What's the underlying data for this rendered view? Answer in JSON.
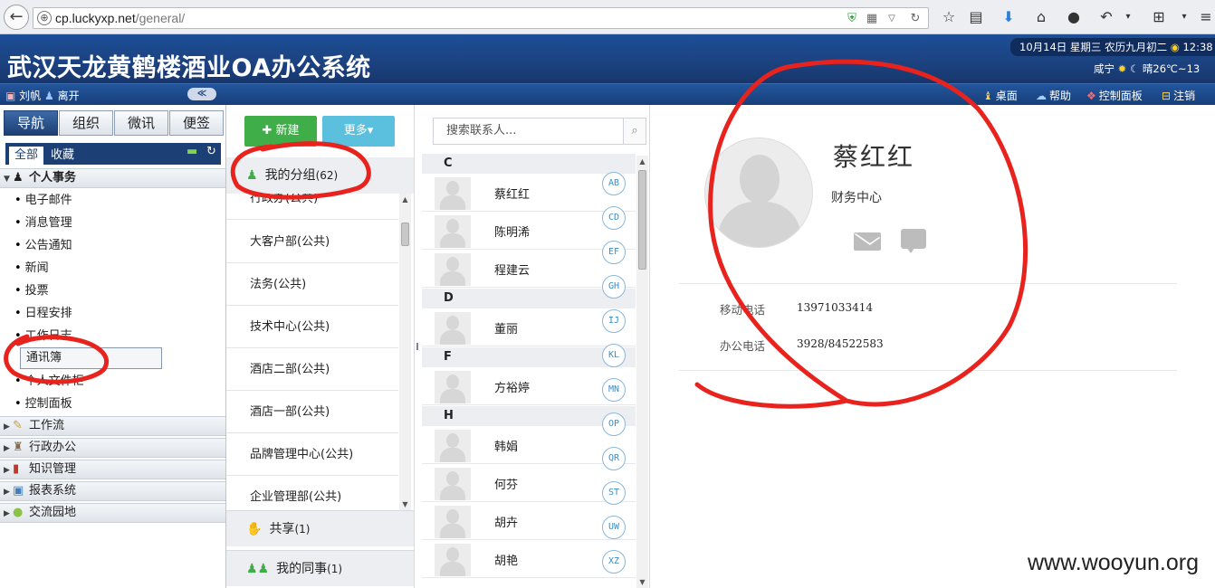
{
  "browser": {
    "url_host": "cp.luckyxp.net",
    "url_path": "/general/",
    "icons": [
      "back-icon",
      "globe-icon",
      "shield-icon",
      "qr-icon",
      "dropdown-icon",
      "reload-icon",
      "star-icon",
      "reader-icon",
      "download-icon",
      "home-icon",
      "chat-icon",
      "undo-icon",
      "crop-icon"
    ]
  },
  "header": {
    "title": "武汉天龙黄鹤楼酒业OA办公系统",
    "date": "10月14日 星期三 农历九月初二",
    "time": "12:38",
    "city": "咸宁",
    "weather": "晴26℃~13"
  },
  "subbar": {
    "user_name": "刘帆",
    "status": "离开",
    "collapse": "≪",
    "links": [
      "桌面",
      "帮助",
      "控制面板",
      "注销"
    ]
  },
  "nav": {
    "tabs": [
      "导航",
      "组织",
      "微讯",
      "便签"
    ],
    "subtabs": [
      "全部",
      "收藏"
    ],
    "sections": {
      "personal": "个人事务",
      "workflow": "工作流",
      "admin": "行政办公",
      "knowledge": "知识管理",
      "report": "报表系统",
      "community": "交流园地"
    },
    "items": [
      "电子邮件",
      "消息管理",
      "公告通知",
      "新闻",
      "投票",
      "日程安排",
      "工作日志",
      "通讯簿",
      "个人文件柜",
      "控制面板"
    ]
  },
  "groups": {
    "new_button": "新建",
    "more_button": "更多",
    "my_groups": "我的分组",
    "my_groups_count": "(62)",
    "list": [
      "行政办(公共)",
      "大客户部(公共)",
      "法务(公共)",
      "技术中心(公共)",
      "酒店二部(公共)",
      "酒店一部(公共)",
      "品牌管理中心(公共)",
      "企业管理部(公共)"
    ],
    "shared": "共享",
    "shared_count": "(1)",
    "colleagues": "我的同事",
    "colleagues_count": "(1)"
  },
  "contacts": {
    "search_placeholder": "搜索联系人...",
    "letters": [
      "C",
      "D",
      "F",
      "H"
    ],
    "names": [
      "蔡红红",
      "陈明浠",
      "程建云",
      "董丽",
      "方裕婷",
      "韩娟",
      "何芬",
      "胡卉",
      "胡艳"
    ],
    "alpha_index": [
      "AB",
      "CD",
      "EF",
      "GH",
      "IJ",
      "KL",
      "MN",
      "OP",
      "QR",
      "ST",
      "UW",
      "XZ"
    ]
  },
  "detail": {
    "name": "蔡红红",
    "department": "财务中心",
    "mobile_label": "移动电话",
    "mobile": "13971033414",
    "office_label": "办公电话",
    "office": "3928/84522583"
  },
  "watermark": "www.wooyun.org",
  "colors": {
    "header_blue": "#1b3f7b",
    "new_green": "#3fae49",
    "more_blue": "#5bc0de",
    "annotation_red": "#e8231e"
  }
}
